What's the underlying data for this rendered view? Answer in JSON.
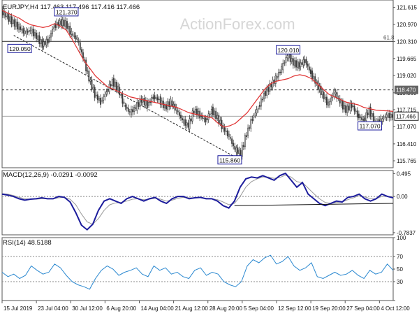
{
  "header": {
    "symbol_line": "EURJPY,H4  117.463 117.496 117.416 117.466",
    "watermark": "ActionForex.com"
  },
  "colors": {
    "candle": "#3a3a3a",
    "ma": "#e03030",
    "macd": "#1c1c9c",
    "macd_signal": "#9a9a9a",
    "rsi": "#2a88d0",
    "grid": "#c8c8c8",
    "label_border": "#1c1c9c"
  },
  "chart_data": [
    {
      "id": "price",
      "type": "line",
      "title": "EURJPY,H4",
      "ylim": [
        115.5,
        121.9
      ],
      "y_ticks": [
        "121.615",
        "120.970",
        "120.310",
        "119.665",
        "119.020",
        "118.360",
        "117.715",
        "117.070",
        "116.410",
        "115.765"
      ],
      "x_ticks": [
        "15 Jul 2019",
        "23 Jul 04:00",
        "30 Jul 12:00",
        "6 Aug 20:00",
        "14 Aug 04:00",
        "21 Aug 12:00",
        "28 Aug 20:00",
        "5 Sep 04:00",
        "12 Sep 12:00",
        "19 Sep 20:00",
        "27 Sep 04:00",
        "4 Oct 12:00"
      ],
      "series": [
        {
          "values": [
            121.45,
            121.25,
            121.05,
            120.85,
            120.65,
            120.75,
            120.5,
            120.2,
            120.35,
            120.9,
            121.05,
            121.0,
            120.6,
            120.4,
            119.7,
            118.9,
            118.3,
            118.0,
            118.4,
            118.8,
            118.5,
            117.9,
            117.6,
            117.8,
            118.1,
            117.9,
            118.2,
            118.1,
            117.8,
            118.0,
            117.7,
            117.3,
            117.1,
            117.7,
            117.5,
            117.3,
            117.7,
            117.4,
            117.0,
            116.7,
            116.2,
            116.05,
            116.8,
            117.4,
            117.8,
            118.3,
            118.6,
            118.9,
            119.3,
            119.8,
            119.5,
            119.4,
            119.6,
            119.1,
            118.7,
            118.3,
            117.9,
            118.4,
            118.0,
            117.7,
            117.9,
            117.5,
            117.3,
            117.7,
            117.2,
            117.3,
            117.5,
            117.47
          ]
        },
        {
          "values": [
            121.5,
            121.4,
            121.3,
            121.2,
            121.05,
            120.95,
            120.9,
            120.85,
            120.9,
            121.0,
            120.9,
            120.75,
            120.4,
            120.0,
            119.6,
            119.3,
            119.0,
            118.8,
            118.6,
            118.5,
            118.4,
            118.3,
            118.2,
            118.15,
            118.1,
            118.05,
            118.0,
            117.95,
            117.9,
            117.85,
            117.8,
            117.7,
            117.6,
            117.55,
            117.5,
            117.45,
            117.4,
            117.2,
            117.05,
            117.1,
            117.2,
            117.4,
            117.6,
            117.9,
            118.2,
            118.5,
            118.7,
            118.8,
            118.85,
            118.9,
            119.0,
            119.05,
            119.0,
            118.9,
            118.7,
            118.5,
            118.3,
            118.2,
            118.1,
            118.0,
            117.95,
            117.9,
            117.8,
            117.75,
            117.7,
            117.68,
            117.67,
            117.65
          ]
        }
      ],
      "hlines": [
        {
          "value": 120.32,
          "label": "61.8",
          "style": "solid"
        },
        {
          "value": 118.47,
          "label": "118.470",
          "style": "dashed"
        },
        {
          "value": 117.466,
          "label": "117.466",
          "style": "current"
        }
      ],
      "trendline": {
        "from_index": 2,
        "from_value": 120.55,
        "to_index": 40,
        "to_value": 115.9
      },
      "annotations": [
        {
          "text": "121.370",
          "index": 11,
          "value": 121.45
        },
        {
          "text": "120.050",
          "index": 3,
          "value": 120.05
        },
        {
          "text": "120.010",
          "index": 49,
          "value": 120.0
        },
        {
          "text": "115.860",
          "index": 39,
          "value": 115.8
        },
        {
          "text": "117.070",
          "index": 63,
          "value": 117.1
        }
      ]
    },
    {
      "id": "macd",
      "type": "line",
      "title": "MACD(12,26,9) -0.0291 -0.0092",
      "ylim": [
        -0.83,
        0.56
      ],
      "y_ticks": [
        "0.495",
        "0.00",
        "-0.7837"
      ],
      "series": [
        {
          "values": [
            0.05,
            0.03,
            0.0,
            -0.05,
            -0.08,
            -0.06,
            -0.05,
            -0.03,
            -0.05,
            -0.05,
            0.0,
            -0.02,
            -0.12,
            -0.35,
            -0.62,
            -0.72,
            -0.6,
            -0.3,
            -0.1,
            -0.05,
            -0.1,
            -0.15,
            -0.05,
            0.0,
            -0.05,
            -0.1,
            -0.05,
            -0.02,
            -0.1,
            -0.15,
            -0.05,
            0.0,
            0.0,
            -0.05,
            -0.03,
            -0.02,
            -0.05,
            -0.05,
            -0.1,
            -0.2,
            -0.25,
            -0.1,
            0.2,
            0.38,
            0.42,
            0.4,
            0.45,
            0.4,
            0.35,
            0.45,
            0.5,
            0.35,
            0.2,
            0.3,
            0.05,
            -0.05,
            -0.15,
            -0.2,
            -0.15,
            -0.1,
            -0.12,
            -0.02,
            0.0,
            0.05,
            -0.05,
            -0.1,
            -0.05,
            0.05,
            0.0,
            -0.03
          ]
        },
        {
          "values": [
            0.06,
            0.05,
            0.02,
            -0.02,
            -0.05,
            -0.06,
            -0.06,
            -0.05,
            -0.05,
            -0.05,
            -0.03,
            -0.02,
            -0.06,
            -0.18,
            -0.38,
            -0.55,
            -0.6,
            -0.48,
            -0.3,
            -0.18,
            -0.14,
            -0.13,
            -0.1,
            -0.06,
            -0.05,
            -0.07,
            -0.06,
            -0.04,
            -0.06,
            -0.1,
            -0.08,
            -0.04,
            -0.02,
            -0.03,
            -0.03,
            -0.03,
            -0.04,
            -0.05,
            -0.07,
            -0.12,
            -0.18,
            -0.15,
            0.0,
            0.2,
            0.32,
            0.38,
            0.42,
            0.42,
            0.39,
            0.41,
            0.46,
            0.42,
            0.32,
            0.3,
            0.18,
            0.06,
            -0.05,
            -0.13,
            -0.15,
            -0.13,
            -0.12,
            -0.07,
            -0.03,
            0.02,
            -0.01,
            -0.05,
            -0.05,
            0.0,
            0.0,
            -0.01
          ]
        }
      ],
      "zero_line": 0.0,
      "trendline": {
        "from_index": 41,
        "from_value": -0.2,
        "to_index": 69,
        "to_value": -0.15
      }
    },
    {
      "id": "rsi",
      "type": "line",
      "title": "RSI(14) 48.5188",
      "ylim": [
        0,
        100
      ],
      "y_ticks": [
        "100",
        "70",
        "50",
        "30",
        "0"
      ],
      "series": [
        {
          "values": [
            45,
            38,
            42,
            35,
            40,
            55,
            48,
            42,
            45,
            58,
            52,
            40,
            30,
            25,
            22,
            18,
            35,
            48,
            55,
            50,
            40,
            45,
            48,
            52,
            42,
            38,
            55,
            48,
            52,
            42,
            45,
            38,
            35,
            48,
            52,
            40,
            45,
            42,
            30,
            25,
            22,
            30,
            55,
            65,
            60,
            68,
            72,
            58,
            62,
            70,
            55,
            48,
            52,
            60,
            38,
            35,
            40,
            45,
            40,
            42,
            48,
            40,
            35,
            48,
            42,
            45,
            58,
            48
          ]
        }
      ],
      "hlines": [
        {
          "value": 70
        },
        {
          "value": 30
        }
      ]
    }
  ]
}
